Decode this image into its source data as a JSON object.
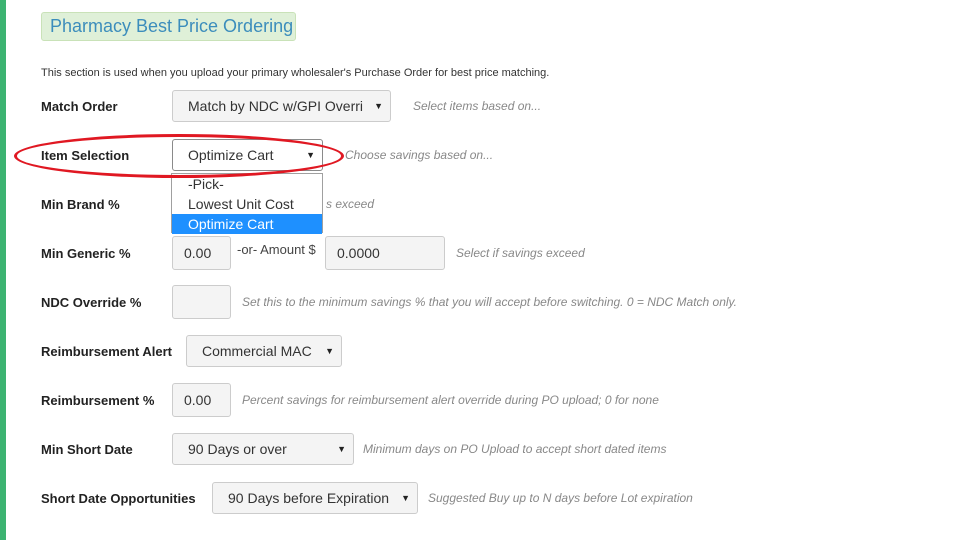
{
  "colors": {
    "accent_bar": "#3cb371",
    "highlight_ellipse": "#e01822",
    "selected_option": "#1e90ff"
  },
  "page": {
    "title": "Pharmacy Best Price Ordering",
    "intro": "This section is used when you upload your primary wholesaler's Purchase Order for best price matching."
  },
  "match_order": {
    "label": "Match Order",
    "value": "Match by NDC w/GPI Overri",
    "hint": "Select items based on..."
  },
  "item_selection": {
    "label": "Item Selection",
    "value": "Optimize Cart",
    "hint": "Choose savings based on...",
    "options": [
      "-Pick-",
      "Lowest Unit Cost",
      "Optimize Cart"
    ]
  },
  "min_brand": {
    "label": "Min Brand %",
    "hint_partial": "s exceed"
  },
  "min_generic": {
    "label": "Min Generic %",
    "percent_value": "0.00",
    "or_text": "-or- Amount $",
    "amount_value": "0.0000",
    "hint": "Select if savings exceed"
  },
  "ndc_override": {
    "label": "NDC Override %",
    "value": "",
    "hint": "Set this to the minimum savings % that you will accept before switching. 0 = NDC Match only."
  },
  "reimbursement_alert": {
    "label": "Reimbursement Alert",
    "value": "Commercial MAC"
  },
  "reimbursement_pct": {
    "label": "Reimbursement %",
    "value": "0.00",
    "hint": "Percent savings for reimbursement alert override during PO upload; 0 for none"
  },
  "min_short_date": {
    "label": "Min Short Date",
    "value": "90 Days or over",
    "hint": "Minimum days on PO Upload to accept short dated items"
  },
  "short_date_opps": {
    "label": "Short Date Opportunities",
    "value": "90 Days before Expiration",
    "hint": "Suggested Buy up to N days before Lot expiration"
  }
}
